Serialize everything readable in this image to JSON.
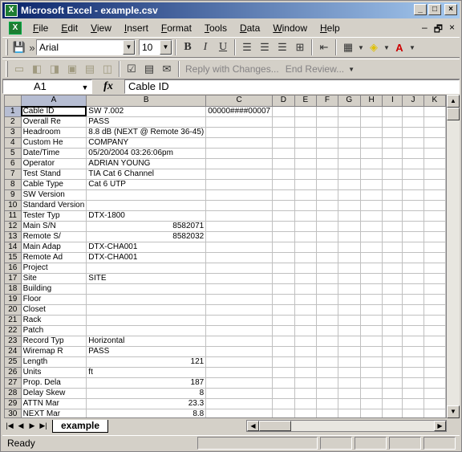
{
  "window": {
    "title": "Microsoft Excel - example.csv"
  },
  "title_buttons": {
    "minimize": "_",
    "maximize": "□",
    "close": "×"
  },
  "menu": {
    "items": [
      "File",
      "Edit",
      "View",
      "Insert",
      "Format",
      "Tools",
      "Data",
      "Window",
      "Help"
    ],
    "right": {
      "minimize": "–",
      "restore": "🗗",
      "close": "×"
    }
  },
  "toolbar": {
    "font_name": "Arial",
    "font_size": "10",
    "bold": "B",
    "italic": "I",
    "underline": "U",
    "reply_with_changes": "Reply with Changes...",
    "end_review": "End Review..."
  },
  "formula_bar": {
    "cell_ref": "A1",
    "fx": "fx",
    "value": "Cable ID"
  },
  "grid": {
    "columns": [
      "A",
      "B",
      "C",
      "D",
      "E",
      "F",
      "G",
      "H",
      "I",
      "J",
      "K"
    ],
    "rows": [
      {
        "n": "1",
        "a": "Cable ID",
        "b": "SW 7.002",
        "c": "00000####00007",
        "num": false
      },
      {
        "n": "2",
        "a": "Overall Re",
        "b": "PASS",
        "num": false
      },
      {
        "n": "3",
        "a": "Headroom",
        "b": "8.8 dB (NEXT @ Remote 36-45)",
        "num": false
      },
      {
        "n": "4",
        "a": "Custom He",
        "b": "COMPANY",
        "num": false
      },
      {
        "n": "5",
        "a": "Date/Time",
        "b": "05/20/2004 03:26:06pm",
        "num": false
      },
      {
        "n": "6",
        "a": "Operator",
        "b": "ADRIAN YOUNG",
        "num": false
      },
      {
        "n": "7",
        "a": "Test Stand",
        "b": "TIA Cat 6 Channel",
        "num": false
      },
      {
        "n": "8",
        "a": "Cable Type",
        "b": "Cat 6 UTP",
        "num": false
      },
      {
        "n": "9",
        "a": "SW Version",
        "b": "",
        "num": false
      },
      {
        "n": "10",
        "a": "Standard Version",
        "b": "",
        "num": false
      },
      {
        "n": "11",
        "a": "Tester Typ",
        "b": "DTX-1800",
        "num": false
      },
      {
        "n": "12",
        "a": "Main S/N",
        "b": "8582071",
        "num": true
      },
      {
        "n": "13",
        "a": "Remote S/",
        "b": "8582032",
        "num": true
      },
      {
        "n": "14",
        "a": "Main Adap",
        "b": "DTX-CHA001",
        "num": false
      },
      {
        "n": "15",
        "a": "Remote Ad",
        "b": "DTX-CHA001",
        "num": false
      },
      {
        "n": "16",
        "a": "Project",
        "b": "",
        "num": false
      },
      {
        "n": "17",
        "a": "Site",
        "b": "SITE",
        "num": false
      },
      {
        "n": "18",
        "a": "Building",
        "b": "",
        "num": false
      },
      {
        "n": "19",
        "a": "Floor",
        "b": "",
        "num": false
      },
      {
        "n": "20",
        "a": "Closet",
        "b": "",
        "num": false
      },
      {
        "n": "21",
        "a": "Rack",
        "b": "",
        "num": false
      },
      {
        "n": "22",
        "a": "Patch",
        "b": "",
        "num": false
      },
      {
        "n": "23",
        "a": "Record Typ",
        "b": "Horizontal",
        "num": false
      },
      {
        "n": "24",
        "a": "Wiremap R",
        "b": "PASS",
        "num": false
      },
      {
        "n": "25",
        "a": "Length",
        "b": "121",
        "num": true
      },
      {
        "n": "26",
        "a": "Units",
        "b": "ft",
        "num": false
      },
      {
        "n": "27",
        "a": "Prop. Dela",
        "b": "187",
        "num": true
      },
      {
        "n": "28",
        "a": "Delay Skew",
        "b": "8",
        "num": true
      },
      {
        "n": "29",
        "a": "ATTN Mar",
        "b": "23.3",
        "num": true
      },
      {
        "n": "30",
        "a": "NEXT Mar",
        "b": "8.8",
        "num": true
      }
    ]
  },
  "sheet_tabs": {
    "active": "example"
  },
  "status": {
    "text": "Ready"
  }
}
